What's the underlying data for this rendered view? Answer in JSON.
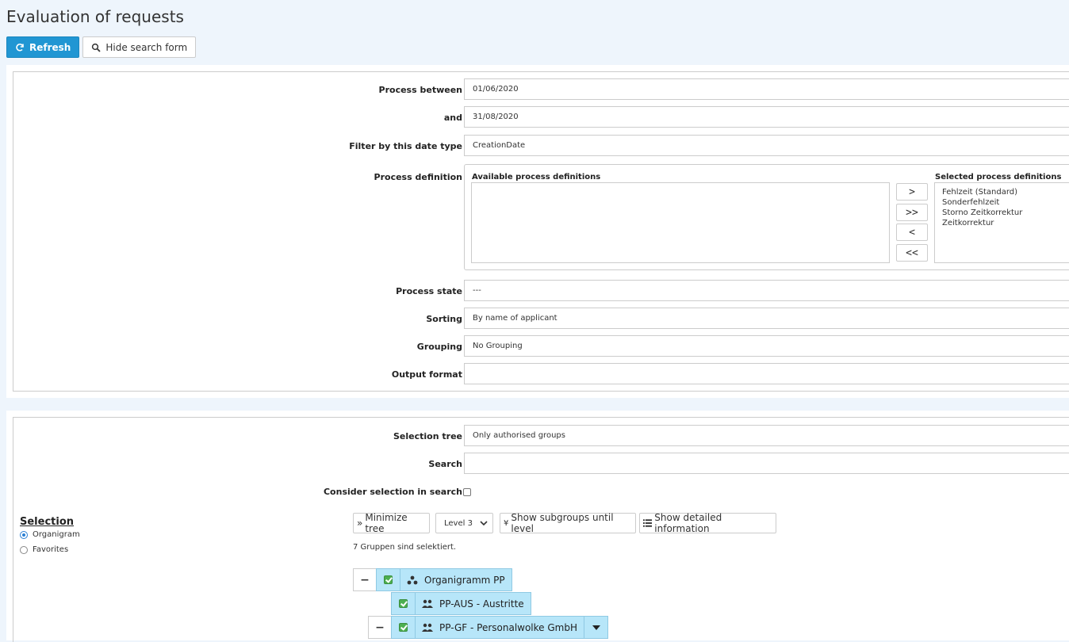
{
  "page": {
    "title": "Evaluation of requests"
  },
  "toolbar": {
    "refresh_label": "Refresh",
    "hide_label": "Hide search form"
  },
  "form": {
    "process_between": {
      "label": "Process between",
      "value": "01/06/2020"
    },
    "and": {
      "label": "and",
      "value": "31/08/2020"
    },
    "date_type": {
      "label": "Filter by this date type",
      "value": "CreationDate"
    },
    "process_definition": {
      "label": "Process definition",
      "available_heading": "Available process definitions",
      "selected_heading": "Selected process definitions",
      "available": [],
      "selected": [
        "Fehlzeit (Standard)",
        "Sonderfehlzeit",
        "Storno Zeitkorrektur",
        "Zeitkorrektur"
      ],
      "buttons": {
        "move_one": ">",
        "move_all": ">>",
        "remove_one": "<",
        "remove_all": "<<"
      }
    },
    "process_state": {
      "label": "Process state",
      "value": "---"
    },
    "sorting": {
      "label": "Sorting",
      "value": "By name of applicant"
    },
    "grouping": {
      "label": "Grouping",
      "value": "No Grouping"
    },
    "output_format": {
      "label": "Output format",
      "value": ""
    }
  },
  "selection": {
    "tree_label": "Selection tree",
    "tree_value": "Only authorised groups",
    "search_label": "Search",
    "search_value": "",
    "consider_label": "Consider selection in search",
    "consider_checked": false,
    "heading": "Selection",
    "options": [
      {
        "label": "Organigram",
        "checked": true
      },
      {
        "label": "Favorites",
        "checked": false
      }
    ],
    "minimize_label": "Minimize tree",
    "level_value": "Level 3",
    "subgroups_label": "Show subgroups until level",
    "detailed_label": "Show detailed information",
    "info_text": "7 Gruppen sind selektiert.",
    "tree": [
      {
        "label": "Organigramm PP",
        "icon": "sitemap-icon"
      },
      {
        "label": "PP-AUS - Austritte",
        "icon": "users-icon"
      },
      {
        "label": "PP-GF - Personalwolke GmbH",
        "icon": "users-icon"
      }
    ],
    "minus_symbol": "−"
  },
  "colors": {
    "primary": "#2196d3",
    "node_bg": "#b7e6f9",
    "background": "#eef5fc"
  }
}
